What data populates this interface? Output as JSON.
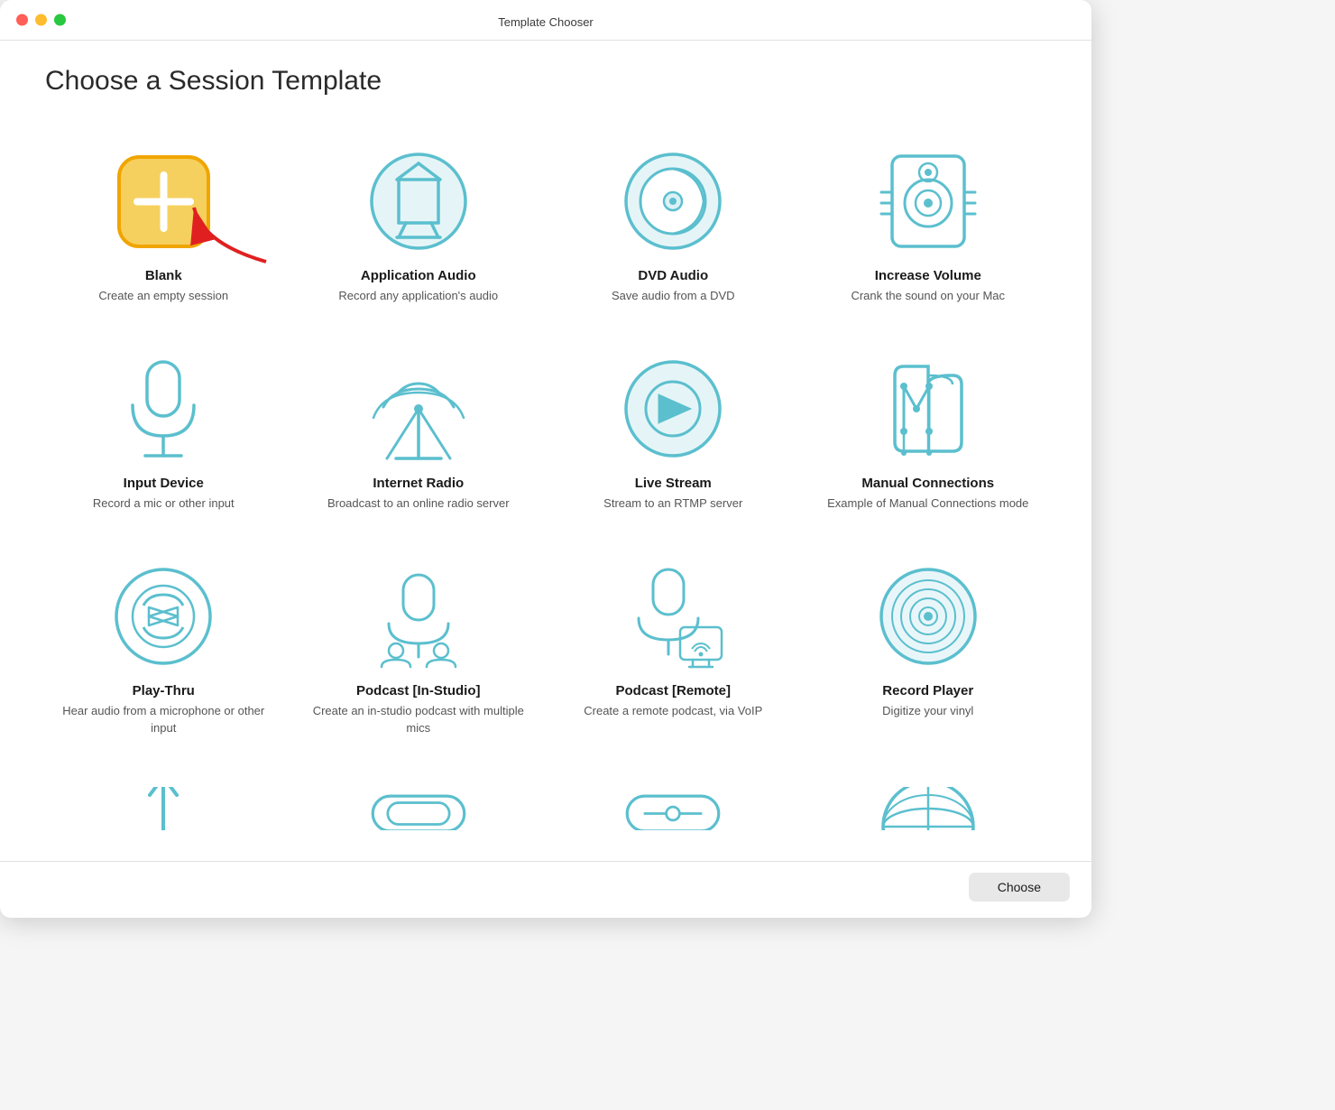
{
  "window": {
    "title": "Template Chooser",
    "page_title": "Choose a Session Template"
  },
  "footer": {
    "choose_label": "Choose"
  },
  "templates": [
    {
      "id": "blank",
      "name": "Blank",
      "desc": "Create an empty session",
      "icon": "blank"
    },
    {
      "id": "application-audio",
      "name": "Application Audio",
      "desc": "Record any application's audio",
      "icon": "app-audio"
    },
    {
      "id": "dvd-audio",
      "name": "DVD Audio",
      "desc": "Save audio from a DVD",
      "icon": "dvd"
    },
    {
      "id": "increase-volume",
      "name": "Increase Volume",
      "desc": "Crank the sound on your Mac",
      "icon": "speaker"
    },
    {
      "id": "input-device",
      "name": "Input Device",
      "desc": "Record a mic or other input",
      "icon": "mic"
    },
    {
      "id": "internet-radio",
      "name": "Internet Radio",
      "desc": "Broadcast to an online radio server",
      "icon": "radio-tower"
    },
    {
      "id": "live-stream",
      "name": "Live Stream",
      "desc": "Stream to an RTMP server",
      "icon": "live-stream"
    },
    {
      "id": "manual-connections",
      "name": "Manual Connections",
      "desc": "Example of Manual Connections mode",
      "icon": "manual"
    },
    {
      "id": "play-thru",
      "name": "Play-Thru",
      "desc": "Hear audio from a microphone or other input",
      "icon": "play-thru"
    },
    {
      "id": "podcast-in-studio",
      "name": "Podcast [In-Studio]",
      "desc": "Create an in-studio podcast with multiple mics",
      "icon": "podcast-studio"
    },
    {
      "id": "podcast-remote",
      "name": "Podcast [Remote]",
      "desc": "Create a remote podcast, via VoIP",
      "icon": "podcast-remote"
    },
    {
      "id": "record-player",
      "name": "Record Player",
      "desc": "Digitize your vinyl",
      "icon": "vinyl"
    }
  ]
}
